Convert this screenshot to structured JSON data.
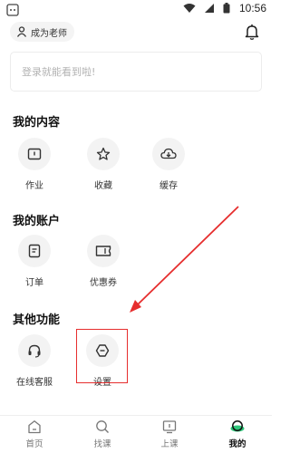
{
  "status_bar": {
    "time": "10:56"
  },
  "header": {
    "become_teacher_label": "成为老师"
  },
  "login": {
    "prompt": "登录就能看到啦!"
  },
  "sections": [
    {
      "title": "我的内容",
      "items": [
        {
          "label": "作业",
          "icon": "homework-icon"
        },
        {
          "label": "收藏",
          "icon": "star-icon"
        },
        {
          "label": "缓存",
          "icon": "cloud-download-icon"
        }
      ]
    },
    {
      "title": "我的账户",
      "items": [
        {
          "label": "订单",
          "icon": "order-icon"
        },
        {
          "label": "优惠券",
          "icon": "coupon-icon"
        }
      ]
    },
    {
      "title": "其他功能",
      "items": [
        {
          "label": "在线客服",
          "icon": "headset-icon"
        },
        {
          "label": "设置",
          "icon": "settings-icon"
        }
      ]
    }
  ],
  "bottom_nav": [
    {
      "label": "首页",
      "icon": "home-icon"
    },
    {
      "label": "找课",
      "icon": "search-icon"
    },
    {
      "label": "上课",
      "icon": "class-icon"
    },
    {
      "label": "我的",
      "icon": "profile-icon",
      "active": true
    }
  ],
  "colors": {
    "accent_green": "#2fc77a",
    "annotation_red": "#e62e2e"
  }
}
